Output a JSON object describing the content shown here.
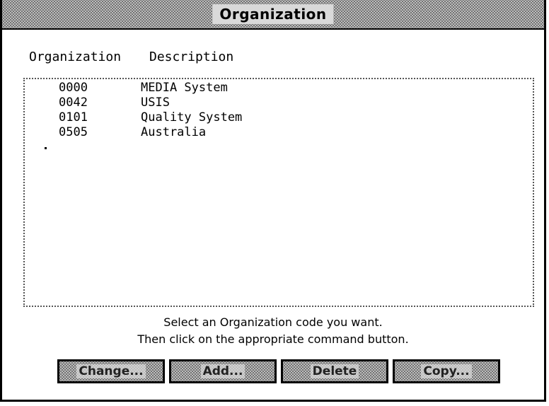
{
  "window": {
    "title": "Organization"
  },
  "columns": {
    "organization": "Organization",
    "description": "Description"
  },
  "rows": [
    {
      "code": "0000",
      "description": "MEDIA System"
    },
    {
      "code": "0042",
      "description": "USIS"
    },
    {
      "code": "0101",
      "description": "Quality System"
    },
    {
      "code": "0505",
      "description": "Australia"
    }
  ],
  "instructions": {
    "line1": "Select an Organization code you want.",
    "line2": "Then click on the appropriate command button."
  },
  "buttons": {
    "change": "Change...",
    "add": "Add...",
    "delete": "Delete",
    "copy": "Copy..."
  }
}
